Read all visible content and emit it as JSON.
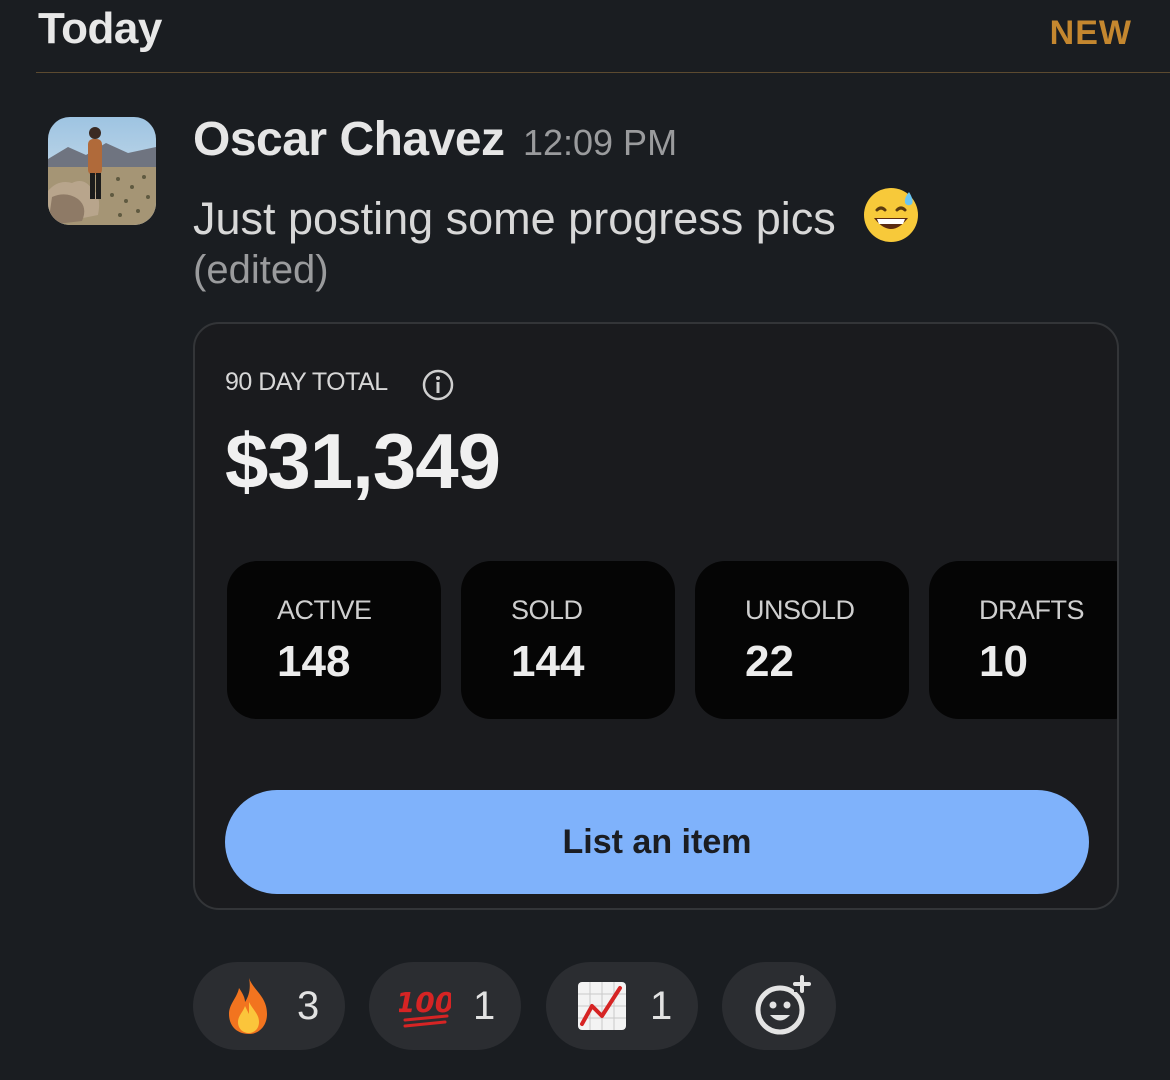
{
  "header": {
    "title": "Today",
    "badge": "NEW"
  },
  "message": {
    "author": "Oscar Chavez",
    "time": "12:09 PM",
    "text": "Just posting some progress pics",
    "text_emoji": "grinning-sweat-emoji",
    "edited": "(edited)"
  },
  "card": {
    "total_label": "90 DAY TOTAL",
    "total_value": "$31,349",
    "stats": [
      {
        "label": "ACTIVE",
        "value": "148"
      },
      {
        "label": "SOLD",
        "value": "144"
      },
      {
        "label": "UNSOLD",
        "value": "22"
      },
      {
        "label": "DRAFTS",
        "value": "10"
      }
    ],
    "button_label": "List an item"
  },
  "reactions": [
    {
      "icon": "fire-emoji",
      "count": "3"
    },
    {
      "icon": "hundred-points-emoji",
      "count": "1"
    },
    {
      "icon": "chart-increasing-emoji",
      "count": "1"
    }
  ],
  "add_reaction_icon": "add-reaction-icon",
  "colors": {
    "background": "#1a1d21",
    "new_badge": "#c4872f",
    "button": "#7fb2fb",
    "reaction_pill": "#2b2d31"
  }
}
